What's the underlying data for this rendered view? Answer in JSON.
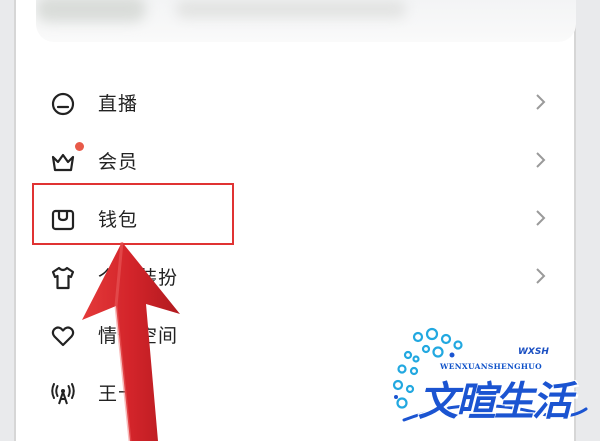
{
  "menu": {
    "items": [
      {
        "label": "直播",
        "icon": "live-icon",
        "has_badge": false
      },
      {
        "label": "会员",
        "icon": "crown-icon",
        "has_badge": true
      },
      {
        "label": "钱包",
        "icon": "wallet-icon",
        "has_badge": false
      },
      {
        "label": "个性装扮",
        "icon": "tshirt-icon",
        "has_badge": false
      },
      {
        "label": "情侣空间",
        "icon": "heart-icon",
        "has_badge": false
      },
      {
        "label": "王卡",
        "icon": "signal-tower-icon",
        "has_badge": false
      }
    ]
  },
  "watermark": {
    "main_text": "文暄生活",
    "sub_text": "WENXUANSHENGHUO",
    "initials": "WXSH"
  },
  "colors": {
    "highlight_border": "#e03333",
    "arrow": "#d3242a",
    "badge": "#e85a49",
    "watermark_blue": "#1b54d1"
  }
}
